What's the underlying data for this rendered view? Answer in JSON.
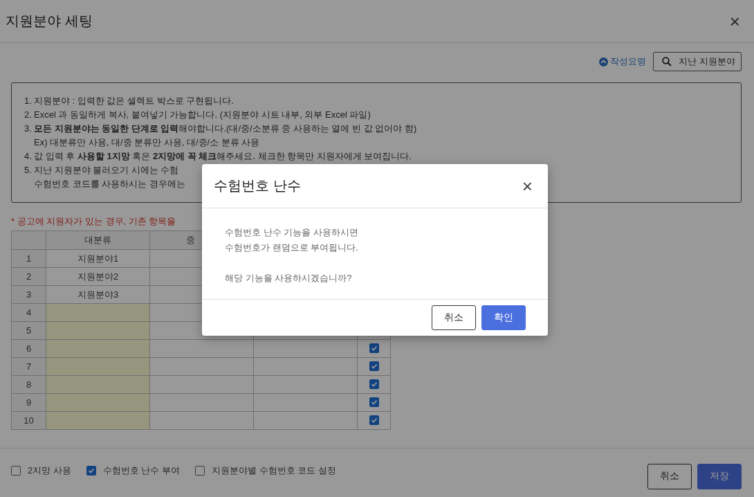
{
  "window": {
    "title": "지원분야 세팅",
    "close": "×"
  },
  "toolbar": {
    "guide_link": "작성요령",
    "history_button": "지난 지원분야"
  },
  "instructions": [
    {
      "number": "1.",
      "lines": [
        "지원분야 : 입력한 값은 셀렉트 박스로 구현됩니다."
      ]
    },
    {
      "number": "2.",
      "lines": [
        "Excel 과 동일하게 복사, 붙여넣기 가능합니다. (지원분야 시트 내부, 외부 Excel 파일)"
      ]
    },
    {
      "number": "3.",
      "lines": [
        "**모든 지원분야는 동일한 단계로 입력**해야합니다.(대/중/소분류 중 사용하는 열에 빈 값 없어야 함)",
        "Ex) 대분류만 사용, 대/중 분류만 사용, 대/중/소 분류 사용"
      ]
    },
    {
      "number": "4.",
      "lines": [
        "값 입력 후 **사용할 1지망** 혹은 **2지망에 꼭 체크**해주세요. 체크한 항목만 지원자에게 보여집니다."
      ]
    },
    {
      "number": "5.",
      "lines": [
        "지난 지원분야 불러오기 시에는 수험",
        "수험번호 코드를 사용하시는 경우에는"
      ]
    }
  ],
  "warning": "* 공고에 지원자가 있는 경우, 기존 항목을",
  "table": {
    "columns": [
      "",
      "대분류",
      "중"
    ],
    "rows": [
      {
        "index": "1",
        "category": "지원분야1",
        "highlighted": false
      },
      {
        "index": "2",
        "category": "지원분야2",
        "highlighted": false
      },
      {
        "index": "3",
        "category": "지원분야3",
        "highlighted": false
      },
      {
        "index": "4",
        "highlighted": true
      },
      {
        "index": "5",
        "highlighted": true
      },
      {
        "index": "6",
        "highlighted": true,
        "checked": true
      },
      {
        "index": "7",
        "highlighted": true,
        "checked": true
      },
      {
        "index": "8",
        "highlighted": true,
        "checked": true
      },
      {
        "index": "9",
        "highlighted": true,
        "checked": true
      },
      {
        "index": "10",
        "highlighted": true,
        "checked": true
      }
    ]
  },
  "footer": {
    "options": [
      {
        "label": "2지망 사용",
        "checked": false
      },
      {
        "label": "수험번호 난수 부여",
        "checked": true
      },
      {
        "label": "지원분야별 수험번호 코드 설정",
        "checked": false
      }
    ],
    "cancel": "취소",
    "save": "저장"
  },
  "dialog": {
    "title": "수험번호 난수",
    "close": "×",
    "paragraphs": [
      [
        "수험번호 난수 기능을 사용하시면",
        "수험번호가 랜덤으로 부여됩니다."
      ],
      [
        "해당 기능을 사용하시겠습니까?"
      ]
    ],
    "cancel": "취소",
    "confirm": "확인"
  }
}
